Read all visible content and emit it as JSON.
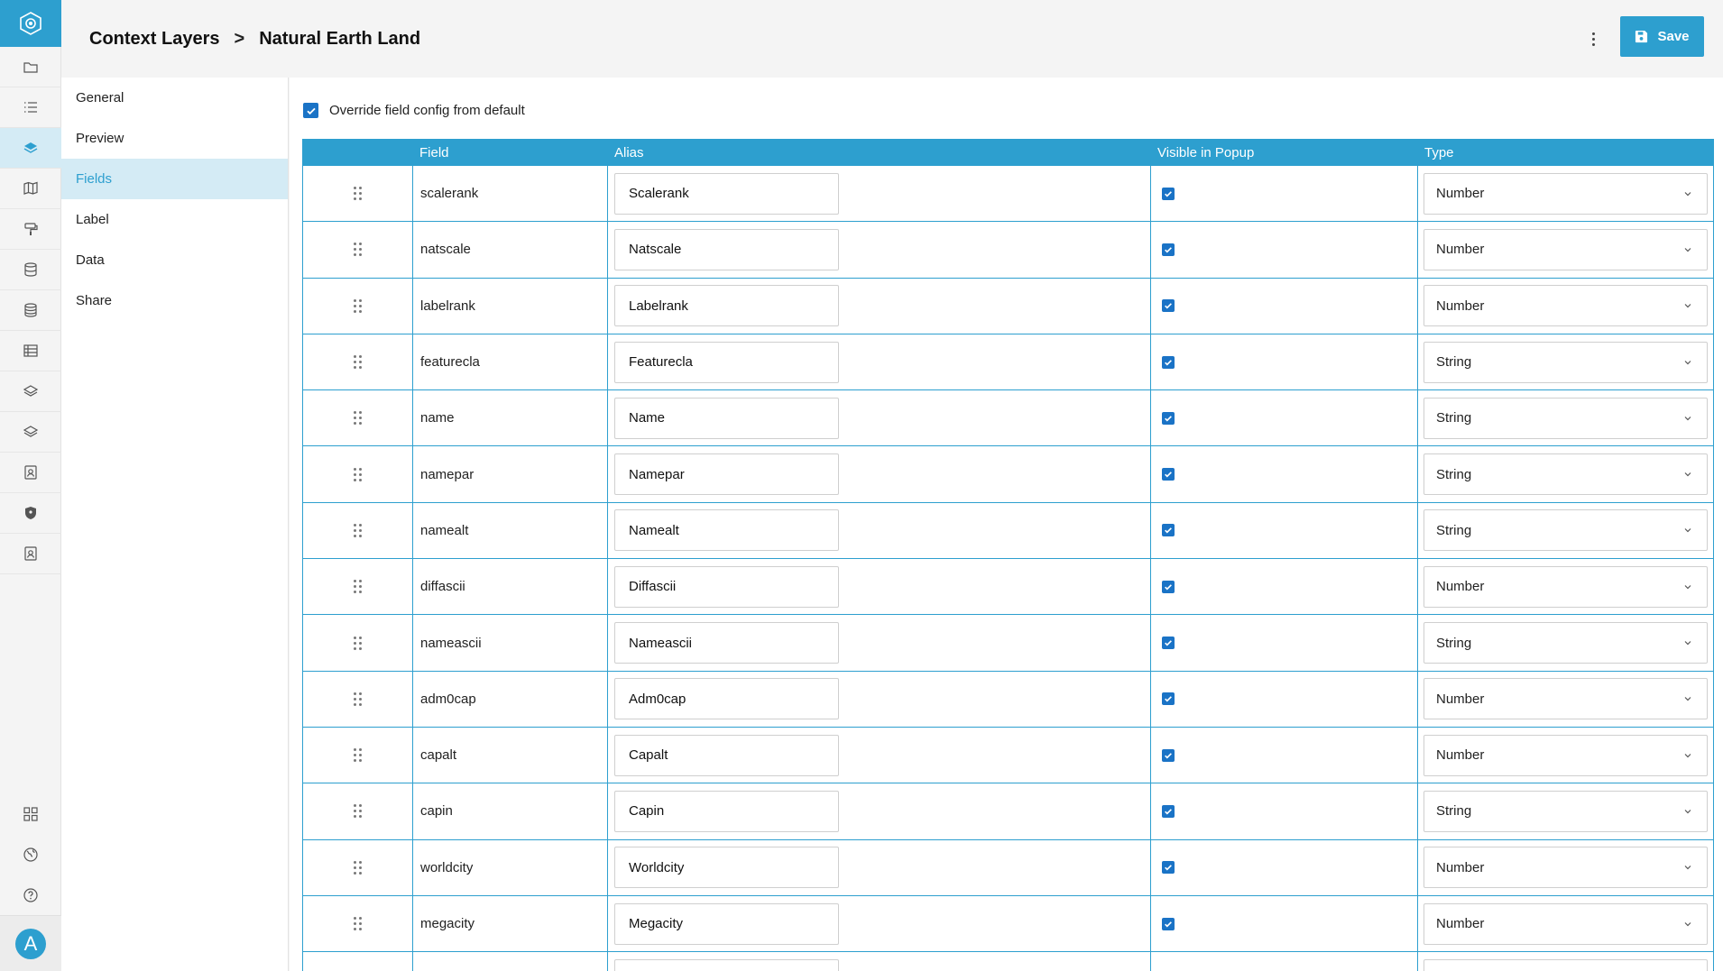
{
  "header": {
    "breadcrumb_parent": "Context Layers",
    "breadcrumb_separator": ">",
    "breadcrumb_current": "Natural Earth Land",
    "save_label": "Save"
  },
  "colors": {
    "accent": "#2d9fcf",
    "checkbox": "#1a73c6",
    "active_bg": "#d4ebf5"
  },
  "rail": {
    "top_icons": [
      "folder-icon",
      "list-icon",
      "layers-icon",
      "map-icon",
      "paint-roller-icon",
      "database-icon",
      "database-stack-icon",
      "table-icon",
      "layers-outline-icon",
      "layers-outline-icon-2",
      "user-card-icon",
      "shield-icon",
      "user-card-icon-2"
    ],
    "active_index": 2,
    "bottom_icons": [
      "grid-icon",
      "globe-icon",
      "help-icon"
    ],
    "avatar_letter": "A"
  },
  "subnav": {
    "items": [
      {
        "label": "General"
      },
      {
        "label": "Preview"
      },
      {
        "label": "Fields"
      },
      {
        "label": "Label"
      },
      {
        "label": "Data"
      },
      {
        "label": "Share"
      }
    ],
    "active_index": 2
  },
  "override": {
    "label": "Override field config from default",
    "checked": true
  },
  "table": {
    "headers": {
      "drag": "",
      "field": "Field",
      "alias": "Alias",
      "visible": "Visible in Popup",
      "type": "Type"
    },
    "rows": [
      {
        "field": "scalerank",
        "alias": "Scalerank",
        "visible": true,
        "type": "Number"
      },
      {
        "field": "natscale",
        "alias": "Natscale",
        "visible": true,
        "type": "Number"
      },
      {
        "field": "labelrank",
        "alias": "Labelrank",
        "visible": true,
        "type": "Number"
      },
      {
        "field": "featurecla",
        "alias": "Featurecla",
        "visible": true,
        "type": "String"
      },
      {
        "field": "name",
        "alias": "Name",
        "visible": true,
        "type": "String"
      },
      {
        "field": "namepar",
        "alias": "Namepar",
        "visible": true,
        "type": "String"
      },
      {
        "field": "namealt",
        "alias": "Namealt",
        "visible": true,
        "type": "String"
      },
      {
        "field": "diffascii",
        "alias": "Diffascii",
        "visible": true,
        "type": "Number"
      },
      {
        "field": "nameascii",
        "alias": "Nameascii",
        "visible": true,
        "type": "String"
      },
      {
        "field": "adm0cap",
        "alias": "Adm0cap",
        "visible": true,
        "type": "Number"
      },
      {
        "field": "capalt",
        "alias": "Capalt",
        "visible": true,
        "type": "Number"
      },
      {
        "field": "capin",
        "alias": "Capin",
        "visible": true,
        "type": "String"
      },
      {
        "field": "worldcity",
        "alias": "Worldcity",
        "visible": true,
        "type": "Number"
      },
      {
        "field": "megacity",
        "alias": "Megacity",
        "visible": true,
        "type": "Number"
      },
      {
        "field": "",
        "alias": "",
        "visible": false,
        "type": ""
      }
    ]
  }
}
